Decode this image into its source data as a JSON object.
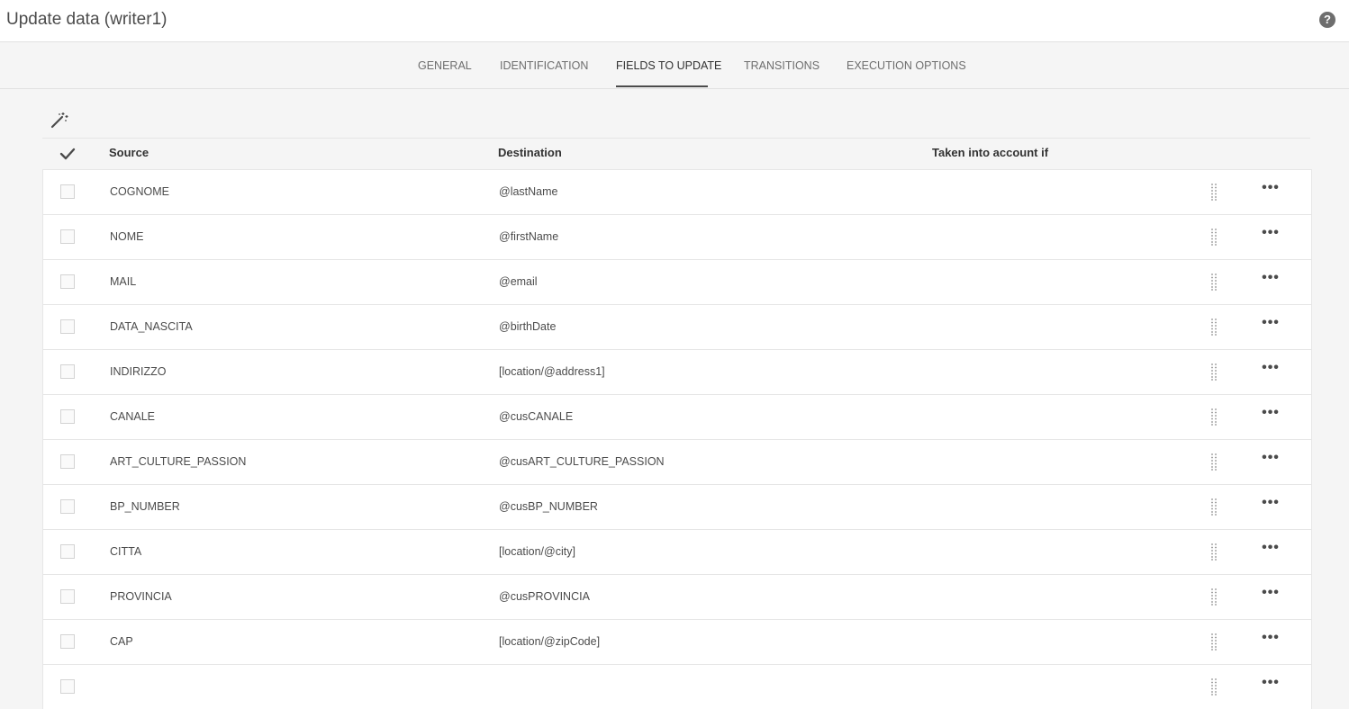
{
  "header": {
    "title": "Update data (writer1)",
    "help_icon": "question-icon",
    "help_glyph": "?"
  },
  "tabs": [
    {
      "label": "GENERAL",
      "active": false
    },
    {
      "label": "IDENTIFICATION",
      "active": false
    },
    {
      "label": "FIELDS TO UPDATE",
      "active": true
    },
    {
      "label": "TRANSITIONS",
      "active": false
    },
    {
      "label": "EXECUTION OPTIONS",
      "active": false
    }
  ],
  "toolbar": {
    "wand_icon": "magic-wand-icon"
  },
  "table": {
    "columns": {
      "source": "Source",
      "destination": "Destination",
      "condition": "Taken into account if"
    },
    "rows": [
      {
        "source": "COGNOME",
        "destination": "@lastName",
        "condition": ""
      },
      {
        "source": "NOME",
        "destination": "@firstName",
        "condition": ""
      },
      {
        "source": "MAIL",
        "destination": "@email",
        "condition": ""
      },
      {
        "source": "DATA_NASCITA",
        "destination": "@birthDate",
        "condition": ""
      },
      {
        "source": "INDIRIZZO",
        "destination": "[location/@address1]",
        "condition": ""
      },
      {
        "source": "CANALE",
        "destination": "@cusCANALE",
        "condition": ""
      },
      {
        "source": "ART_CULTURE_PASSION",
        "destination": "@cusART_CULTURE_PASSION",
        "condition": ""
      },
      {
        "source": "BP_NUMBER",
        "destination": "@cusBP_NUMBER",
        "condition": ""
      },
      {
        "source": "CITTA",
        "destination": "[location/@city]",
        "condition": ""
      },
      {
        "source": "PROVINCIA",
        "destination": "@cusPROVINCIA",
        "condition": ""
      },
      {
        "source": "CAP",
        "destination": "[location/@zipCode]",
        "condition": ""
      },
      {
        "source": "",
        "destination": "",
        "condition": ""
      }
    ],
    "more_glyph": "•••"
  },
  "colors": {
    "background": "#f5f5f5",
    "surface": "#ffffff",
    "border": "#e6e6e6",
    "text": "#323232",
    "muted": "#6e6e6e"
  }
}
